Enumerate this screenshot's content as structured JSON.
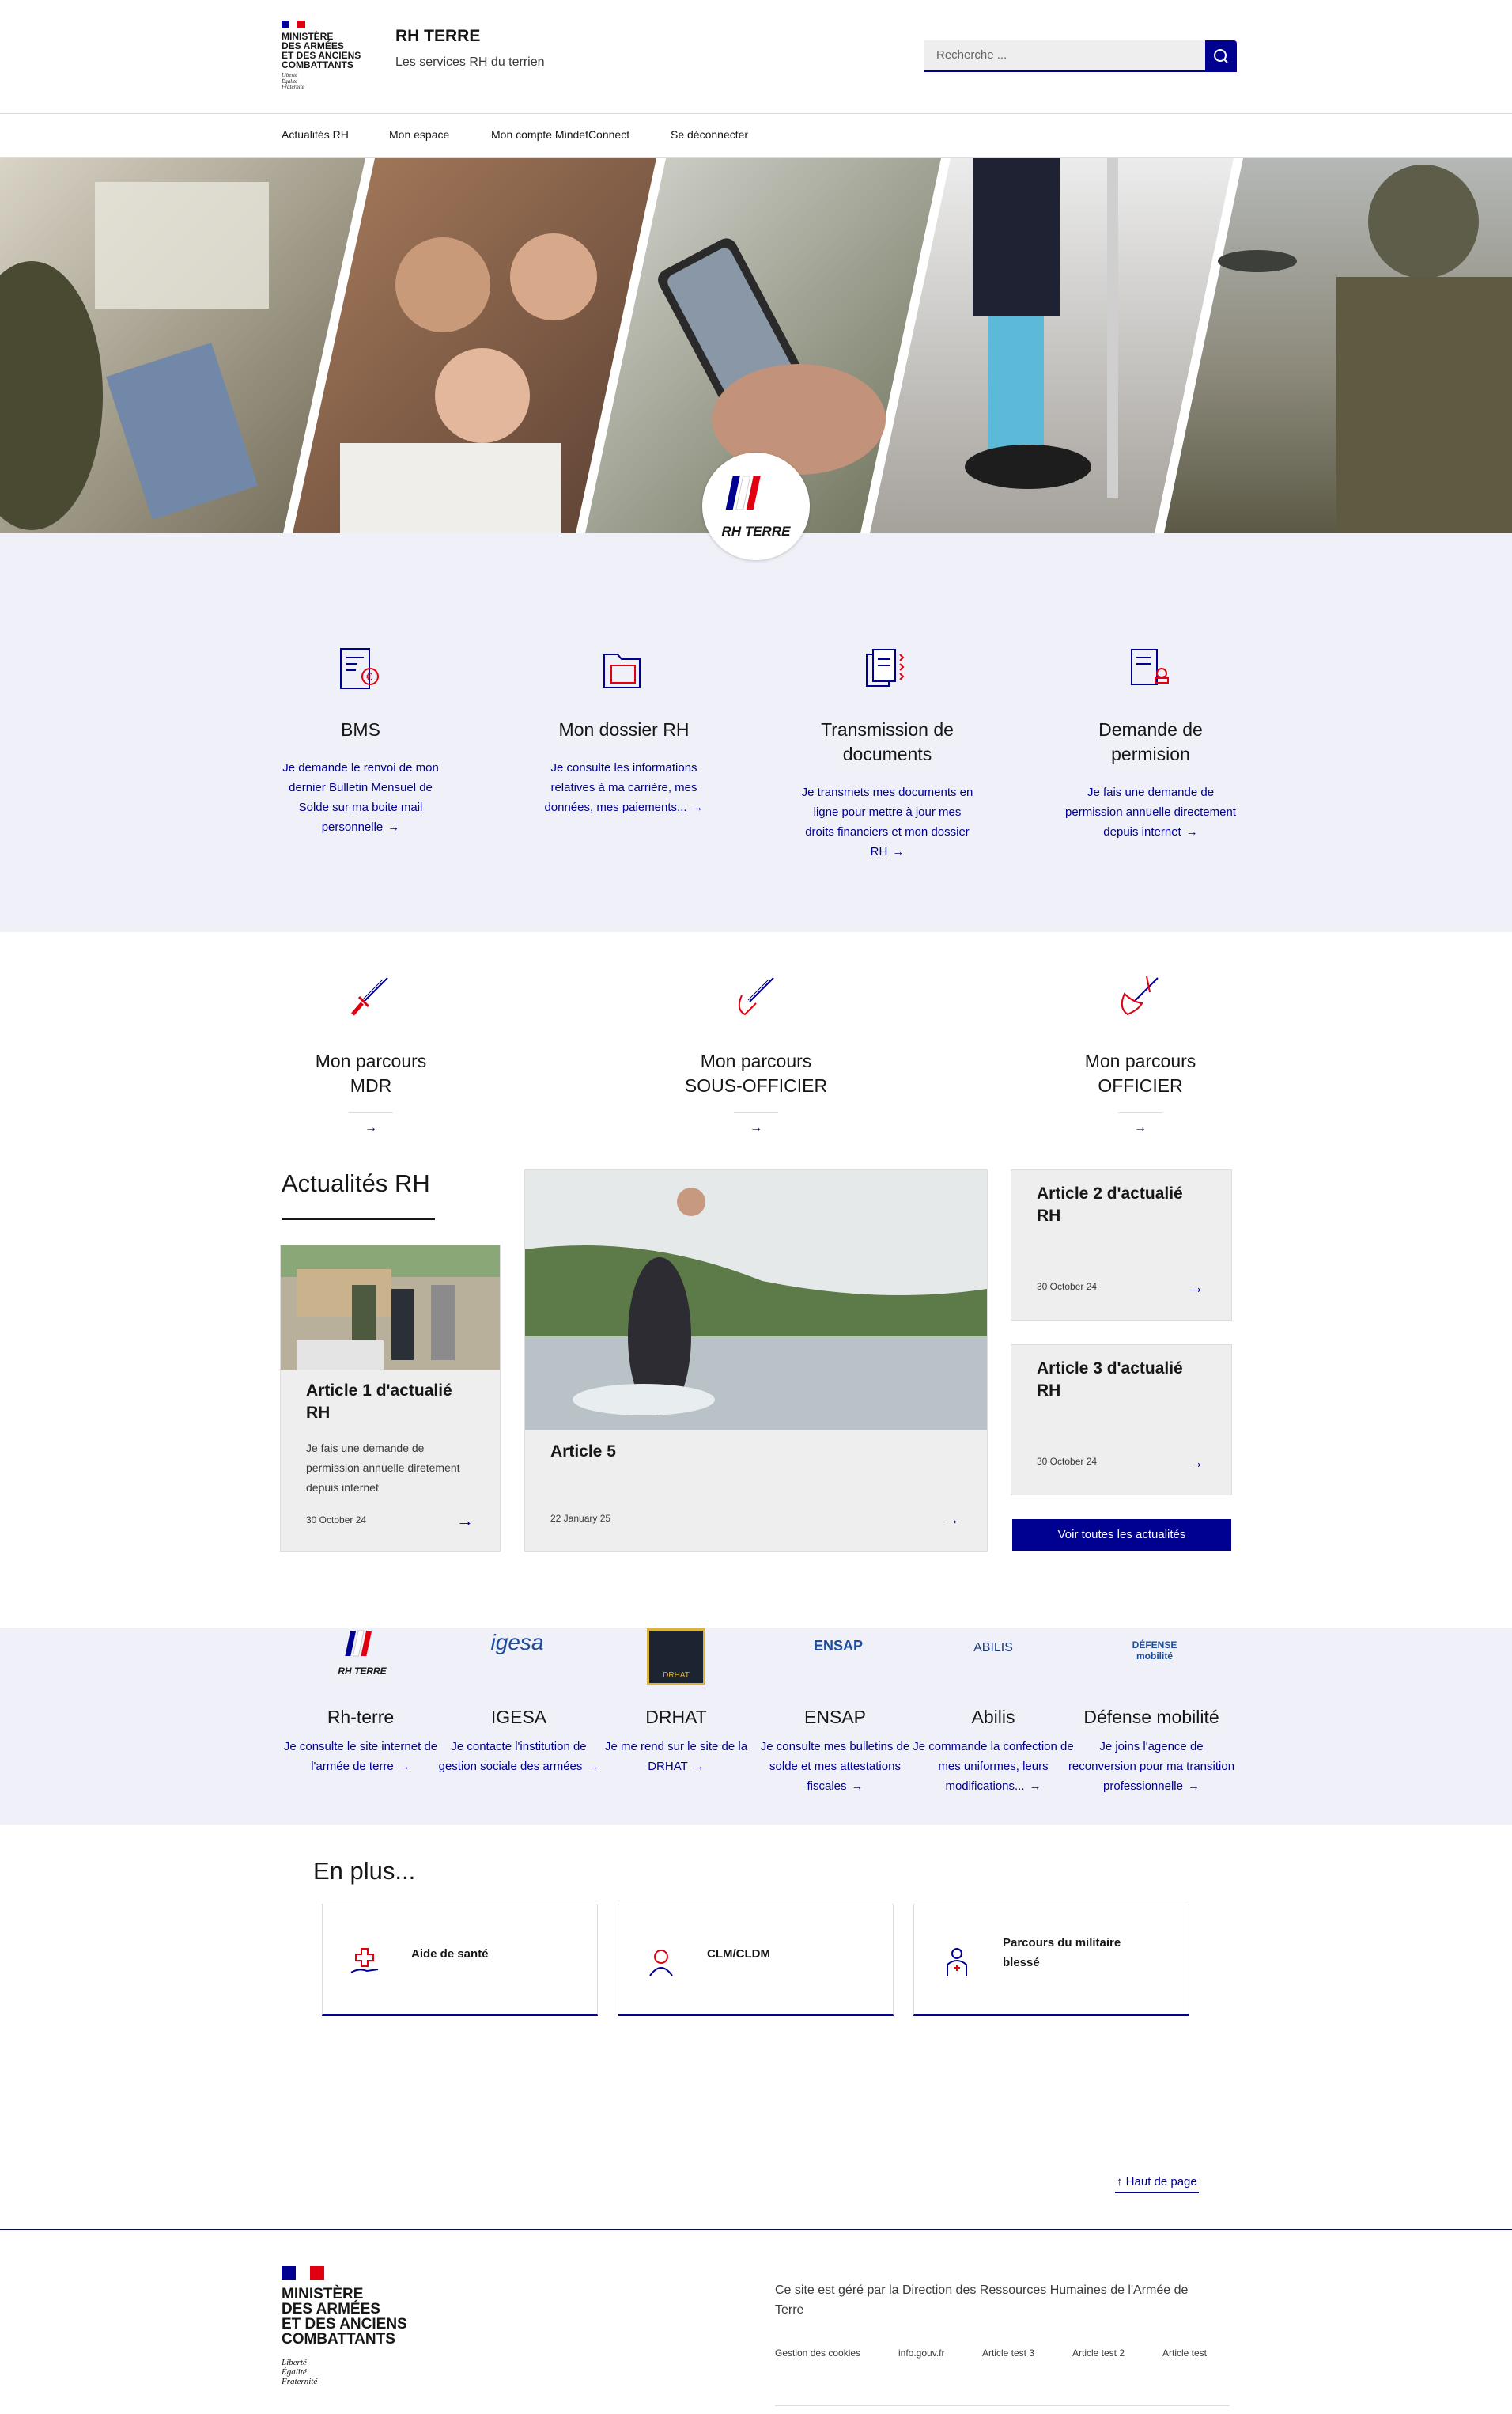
{
  "header": {
    "ministry_lines": [
      "Ministère",
      "des Armées",
      "et des Anciens",
      "Combattants"
    ],
    "motto": [
      "Liberté",
      "Égalité",
      "Fraternité"
    ],
    "site_title": "RH TERRE",
    "site_tagline": "Les services RH du terrien",
    "search_placeholder": "Recherche ...",
    "search_icon": "search-icon"
  },
  "nav": {
    "items": [
      "Actualités RH",
      "Mon espace",
      "Mon compte MindefConnect",
      "Se déconnecter"
    ]
  },
  "hero": {
    "logo_text": "RH TERRE"
  },
  "services": [
    {
      "title": "BMS",
      "desc": "Je demande le renvoi de mon dernier Bulletin Mensuel de Solde sur ma boite mail personnelle",
      "icon": "payslip-euro-icon"
    },
    {
      "title": "Mon dossier RH",
      "desc": "Je consulte les informations relatives à ma carrière, mes données, mes paiements...",
      "icon": "folder-icon"
    },
    {
      "title": "Transmission de documents",
      "desc": "Je transmets mes documents en ligne pour mettre à jour mes droits financiers et mon dossier RH",
      "icon": "documents-transfer-icon"
    },
    {
      "title": "Demande de permision",
      "desc": "Je fais une demande de permission annuelle directement depuis internet",
      "icon": "stamped-document-icon"
    }
  ],
  "parcours": [
    {
      "line1": "Mon parcours",
      "line2": "MDR",
      "icon": "dagger-icon"
    },
    {
      "line1": "Mon parcours",
      "line2": "SOUS-OFFICIER",
      "icon": "sabre-icon"
    },
    {
      "line1": "Mon parcours",
      "line2": "OFFICIER",
      "icon": "officer-sword-icon"
    }
  ],
  "news": {
    "title": "Actualités RH",
    "cards": [
      {
        "title": "Article 1 d'actualié RH",
        "desc": "Je fais une demande de permission annuelle diretement depuis internet",
        "date": "30 October 24"
      },
      {
        "title": "Article 5",
        "desc": "",
        "date": "22 January 25"
      },
      {
        "title": "Article 2 d'actualié RH",
        "desc": "",
        "date": "30 October 24"
      },
      {
        "title": "Article 3 d'actualié RH",
        "desc": "",
        "date": "30 October 24"
      }
    ],
    "see_all": "Voir toutes les actualités"
  },
  "partners": [
    {
      "name": "Rh-terre",
      "desc": "Je consulte le site internet de l'armée de terre",
      "logo": "RH TERRE"
    },
    {
      "name": "IGESA",
      "desc": "Je contacte l'institution de gestion sociale des armées",
      "logo": "igesa"
    },
    {
      "name": "DRHAT",
      "desc": "Je me rend sur le site de la DRHAT",
      "logo": "DRHAT"
    },
    {
      "name": "ENSAP",
      "desc": "Je consulte mes bulletins de solde et mes attestations fiscales",
      "logo": "ENSAP"
    },
    {
      "name": "Abilis",
      "desc": "Je commande la confection de mes uniformes, leurs modifications...",
      "logo": "ABILIS"
    },
    {
      "name": "Défense mobilité",
      "desc": "Je joins l'agence de reconversion pour ma transition professionnelle",
      "logo": "DÉFENSE mobilité"
    }
  ],
  "en_plus": {
    "title": "En plus...",
    "items": [
      {
        "label": "Aide de santé",
        "icon": "health-hand-icon"
      },
      {
        "label": "CLM/CLDM",
        "icon": "person-icon"
      },
      {
        "label": "Parcours du militaire blessé",
        "icon": "wounded-soldier-icon"
      }
    ]
  },
  "back_to_top": "Haut de page",
  "footer": {
    "ministry_lines": [
      "Ministère",
      "des Armées",
      "et des Anciens",
      "Combattants"
    ],
    "motto": [
      "Liberté",
      "Égalité",
      "Fraternité"
    ],
    "description": "Ce site est géré par la Direction des Ressources Humaines de l'Armée de Terre",
    "links": [
      "Gestion des cookies",
      "info.gouv.fr",
      "Article test 3",
      "Article test 2",
      "Article test"
    ]
  },
  "colors": {
    "primary": "#000091",
    "marianne_red": "#e1000f",
    "band_bg": "#f0f0f8"
  }
}
